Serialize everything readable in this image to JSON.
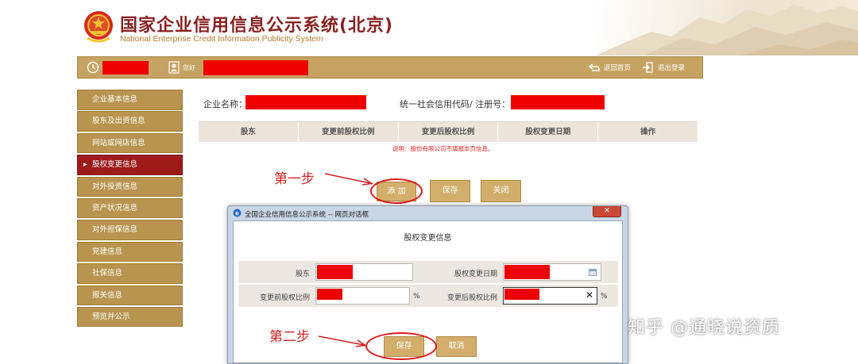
{
  "header": {
    "title": "国家企业信用信息公示系统(北京)",
    "subtitle": "National Enterprise Credit Information Publicity System"
  },
  "topbar": {
    "greeting": "您好",
    "home_link": "返回首页",
    "logout_link": "退出登录"
  },
  "sidebar": {
    "items": [
      {
        "label": "企业基本信息",
        "active": false
      },
      {
        "label": "股东及出资信息",
        "active": false
      },
      {
        "label": "网站或网店信息",
        "active": false
      },
      {
        "label": "股权变更信息",
        "active": true
      },
      {
        "label": "对外投资信息",
        "active": false
      },
      {
        "label": "资产状况信息",
        "active": false
      },
      {
        "label": "对外担保信息",
        "active": false
      },
      {
        "label": "党建信息",
        "active": false
      },
      {
        "label": "社保信息",
        "active": false
      },
      {
        "label": "报关信息",
        "active": false
      },
      {
        "label": "预览并公示",
        "active": false
      }
    ]
  },
  "main": {
    "company_name_label": "企业名称：",
    "credit_code_label": "统一社会信用代码/ 注册号：",
    "table_headers": [
      "股东",
      "变更前股权比例",
      "变更后股权比例",
      "股权变更日期",
      "操作"
    ],
    "note": "说明：股份有限公司不填报本页信息。",
    "buttons": {
      "add": "添 加",
      "save": "保存",
      "close": "关闭"
    }
  },
  "annotations": {
    "step1": "第一步",
    "step2": "第二步"
  },
  "dialog": {
    "title": "全国企业信用信息公示系统 -- 网页对话框",
    "close_label": "✕",
    "heading": "股权变更信息",
    "fields": {
      "shareholder_label": "股东",
      "change_date_label": "股权变更日期",
      "before_ratio_label": "变更前股权比例",
      "after_ratio_label": "变更后股权比例",
      "percent_unit": "%",
      "clear_mark": "✕"
    },
    "buttons": {
      "save": "保存",
      "cancel": "取消"
    }
  },
  "watermark": "知乎 @通晓说资质",
  "colors": {
    "gold": "#c7a363",
    "sidebar_active": "#9e1b1b",
    "redaction": "#ee0000",
    "annotation_red": "#d42020"
  }
}
